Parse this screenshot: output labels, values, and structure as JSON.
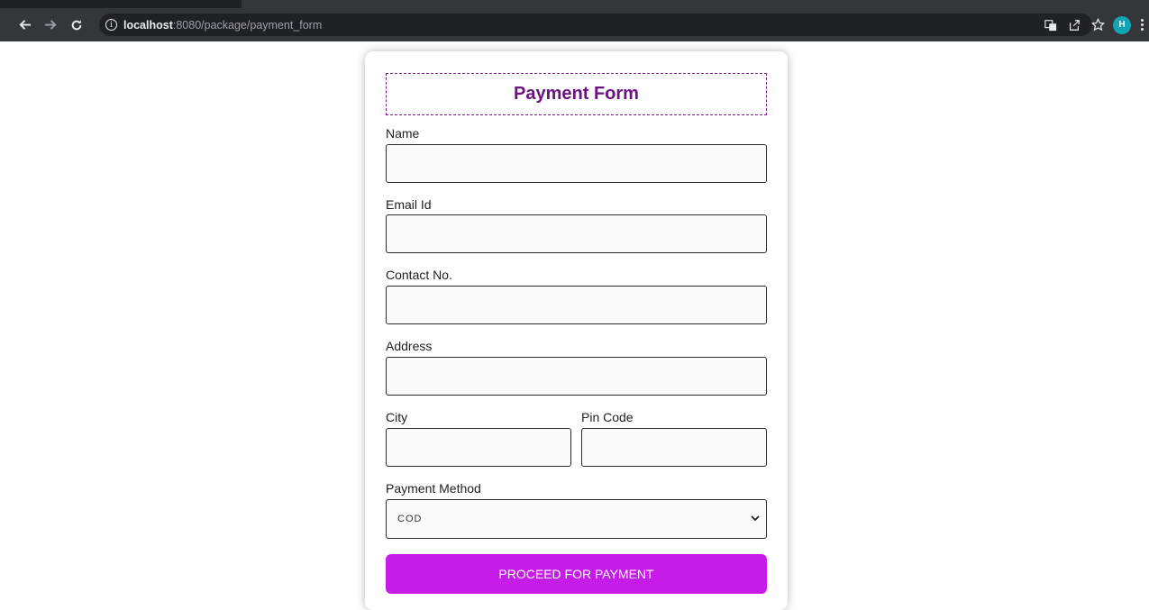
{
  "browser": {
    "url_host": "localhost",
    "url_rest": ":8080/package/payment_form",
    "avatar_initial": "H",
    "icons": [
      "back-arrow-icon",
      "forward-arrow-icon",
      "reload-icon",
      "info-icon",
      "translate-icon",
      "share-icon",
      "bookmark-star-icon",
      "menu-dots-icon"
    ]
  },
  "form": {
    "title": "Payment Form",
    "name_label": "Name",
    "email_label": "Email Id",
    "contact_label": "Contact No.",
    "address_label": "Address",
    "city_label": "City",
    "pin_label": "Pin Code",
    "payment_method_label": "Payment Method",
    "payment_method_selected": "COD",
    "submit_label": "PROCEED FOR PAYMENT"
  },
  "colors": {
    "title": "#6b1380",
    "title_border": "#7a1a8a",
    "button": "#c61ce8",
    "avatar": "#12a4b5"
  }
}
